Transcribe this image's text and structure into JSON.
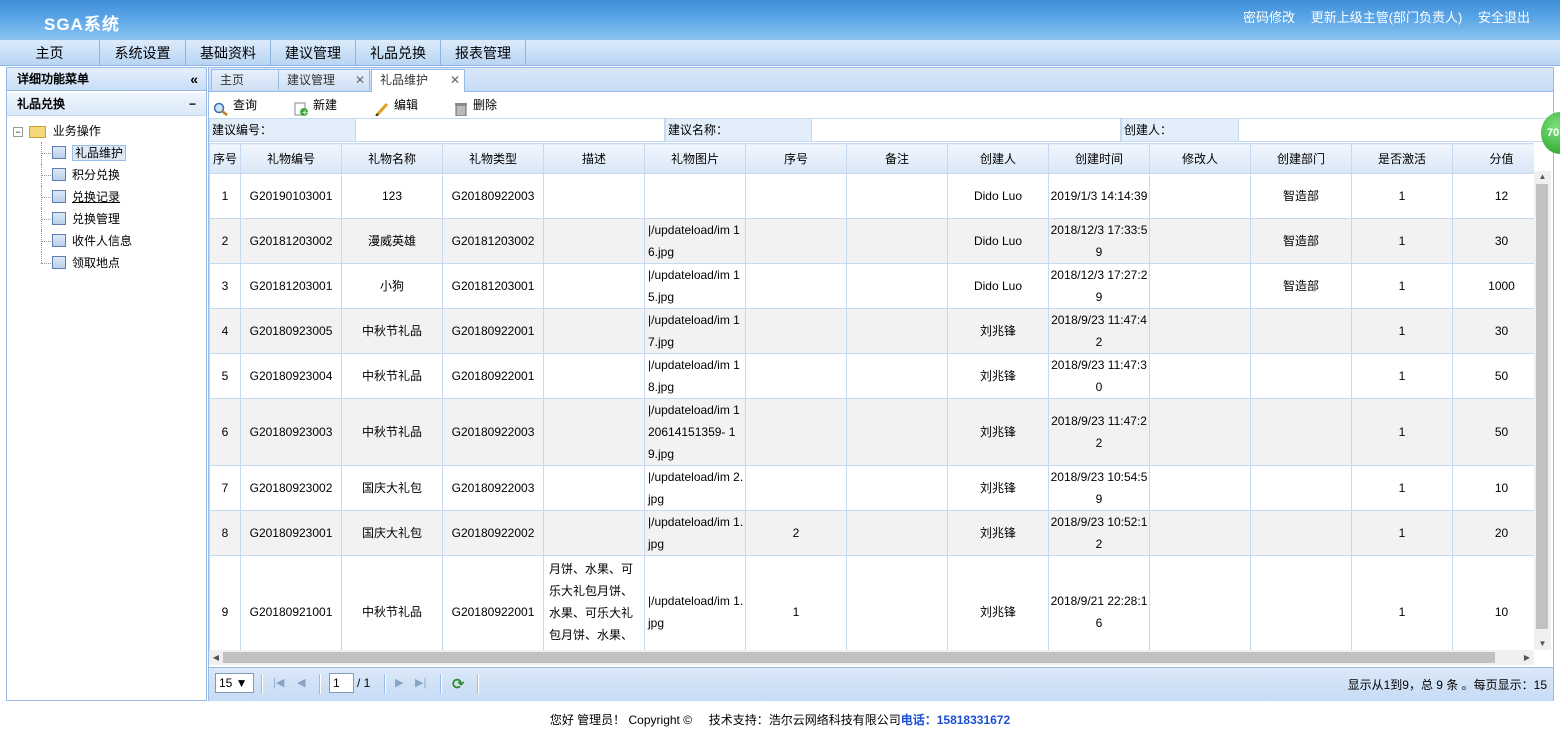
{
  "app": {
    "title": "SGA系统",
    "header_links": [
      "密码修改",
      "更新上级主管(部门负责人)",
      "安全退出"
    ]
  },
  "nav": [
    "主页",
    "系统设置",
    "基础资料",
    "建议管理",
    "礼品兑换",
    "报表管理"
  ],
  "sidebar": {
    "title": "详细功能菜单",
    "collapse_glyph": "«",
    "group": "礼品兑换",
    "group_glyph": "−",
    "tree_root": "业务操作",
    "items": [
      {
        "label": "礼品维护",
        "active": true
      },
      {
        "label": "积分兑换"
      },
      {
        "label": "兑换记录"
      },
      {
        "label": "兑换管理"
      },
      {
        "label": "收件人信息"
      },
      {
        "label": "领取地点"
      }
    ]
  },
  "tabs": [
    {
      "label": "主页",
      "closable": false
    },
    {
      "label": "建议管理",
      "closable": true
    },
    {
      "label": "礼品维护",
      "closable": true,
      "active": true
    }
  ],
  "toolbar": {
    "query": "查询",
    "new": "新建",
    "edit": "编辑",
    "delete": "删除"
  },
  "search": {
    "no_label": "建议编号：",
    "name_label": "建议名称：",
    "creator_label": "创建人："
  },
  "grid": {
    "columns": [
      "序号",
      "礼物编号",
      "礼物名称",
      "礼物类型",
      "描述",
      "礼物图片",
      "序号",
      "备注",
      "创建人",
      "创建时间",
      "修改人",
      "创建部门",
      "是否激活",
      "分值"
    ],
    "rows": [
      {
        "no": "1",
        "code": "G20190103001",
        "name": "123",
        "type": "G20180922003",
        "desc": "",
        "img": "",
        "seq": "",
        "remark": "",
        "creator": "Dido Luo",
        "time": "2019/1/3 14:14:39",
        "modifier": "",
        "dept": "智造部",
        "active": "1",
        "score": "12"
      },
      {
        "no": "2",
        "code": "G20181203002",
        "name": "漫威英雄",
        "type": "G20181203002",
        "desc": "",
        "img": "|/updateload/im 16.jpg",
        "seq": "",
        "remark": "",
        "creator": "Dido Luo",
        "time": "2018/12/3 17:33:59",
        "modifier": "",
        "dept": "智造部",
        "active": "1",
        "score": "30"
      },
      {
        "no": "3",
        "code": "G20181203001",
        "name": "小狗",
        "type": "G20181203001",
        "desc": "",
        "img": "|/updateload/im 15.jpg",
        "seq": "",
        "remark": "",
        "creator": "Dido Luo",
        "time": "2018/12/3 17:27:29",
        "modifier": "",
        "dept": "智造部",
        "active": "1",
        "score": "1000"
      },
      {
        "no": "4",
        "code": "G20180923005",
        "name": "中秋节礼品",
        "type": "G20180922001",
        "desc": "",
        "img": "|/updateload/im 17.jpg",
        "seq": "",
        "remark": "",
        "creator": "刘兆锋",
        "time": "2018/9/23 11:47:42",
        "modifier": "",
        "dept": "",
        "active": "1",
        "score": "30"
      },
      {
        "no": "5",
        "code": "G20180923004",
        "name": "中秋节礼品",
        "type": "G20180922001",
        "desc": "",
        "img": "|/updateload/im 18.jpg",
        "seq": "",
        "remark": "",
        "creator": "刘兆锋",
        "time": "2018/9/23 11:47:30",
        "modifier": "",
        "dept": "",
        "active": "1",
        "score": "50"
      },
      {
        "no": "6",
        "code": "G20180923003",
        "name": "中秋节礼品",
        "type": "G20180922003",
        "desc": "",
        "img": "|/updateload/im 120614151359- 19.jpg",
        "seq": "",
        "remark": "",
        "creator": "刘兆锋",
        "time": "2018/9/23 11:47:22",
        "modifier": "",
        "dept": "",
        "active": "1",
        "score": "50"
      },
      {
        "no": "7",
        "code": "G20180923002",
        "name": "国庆大礼包",
        "type": "G20180922003",
        "desc": "",
        "img": "|/updateload/im 2.jpg",
        "seq": "",
        "remark": "",
        "creator": "刘兆锋",
        "time": "2018/9/23 10:54:59",
        "modifier": "",
        "dept": "",
        "active": "1",
        "score": "10"
      },
      {
        "no": "8",
        "code": "G20180923001",
        "name": "国庆大礼包",
        "type": "G20180922002",
        "desc": "",
        "img": "|/updateload/im 1.jpg",
        "seq": "2",
        "remark": "",
        "creator": "刘兆锋",
        "time": "2018/9/23 10:52:12",
        "modifier": "",
        "dept": "",
        "active": "1",
        "score": "20"
      },
      {
        "no": "9",
        "code": "G20180921001",
        "name": "中秋节礼品",
        "type": "G20180922001",
        "desc": "月饼、水果、可乐大礼包月饼、水果、可乐大礼包月饼、水果、可乐大礼包",
        "img": "|/updateload/im 1.jpg",
        "seq": "1",
        "remark": "",
        "creator": "刘兆锋",
        "time": "2018/9/21 22:28:16",
        "modifier": "",
        "dept": "",
        "active": "1",
        "score": "10"
      }
    ]
  },
  "pager": {
    "page_size": "15 ▼",
    "page": "1",
    "total_pages": "/ 1",
    "info": "显示从1到9，总 9 条 。每页显示：15"
  },
  "footer": {
    "greeting": "您好 管理员！ Copyright ©",
    "support": "技术支持：浩尔云网络科技有限公司",
    "phone": "电话：15818331672"
  },
  "badge": "70"
}
